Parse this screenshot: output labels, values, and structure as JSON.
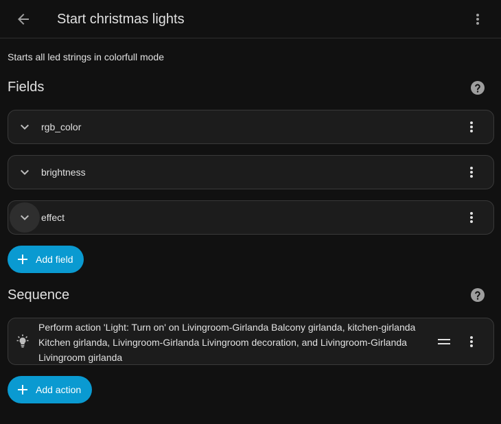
{
  "header": {
    "title": "Start christmas lights",
    "back_icon": "arrow-left-icon",
    "menu_icon": "dots-vertical-icon"
  },
  "description": "Starts all led strings in colorfull mode",
  "fields": {
    "heading": "Fields",
    "items": [
      {
        "name": "rgb_color"
      },
      {
        "name": "brightness"
      },
      {
        "name": "effect"
      }
    ],
    "add_label": "Add field"
  },
  "sequence": {
    "heading": "Sequence",
    "action_text": "Perform action 'Light: Turn on' on Livingroom-Girlanda Balcony girlanda, kitchen-girlanda Kitchen girlanda, Livingroom-Girlanda Livingroom decoration, and Livingroom-Girlanda Livingroom girlanda",
    "action_icon": "lightbulb-icon",
    "add_label": "Add action"
  },
  "colors": {
    "accent": "#0a9ad1",
    "background": "#111111",
    "card": "#1c1c1c"
  }
}
